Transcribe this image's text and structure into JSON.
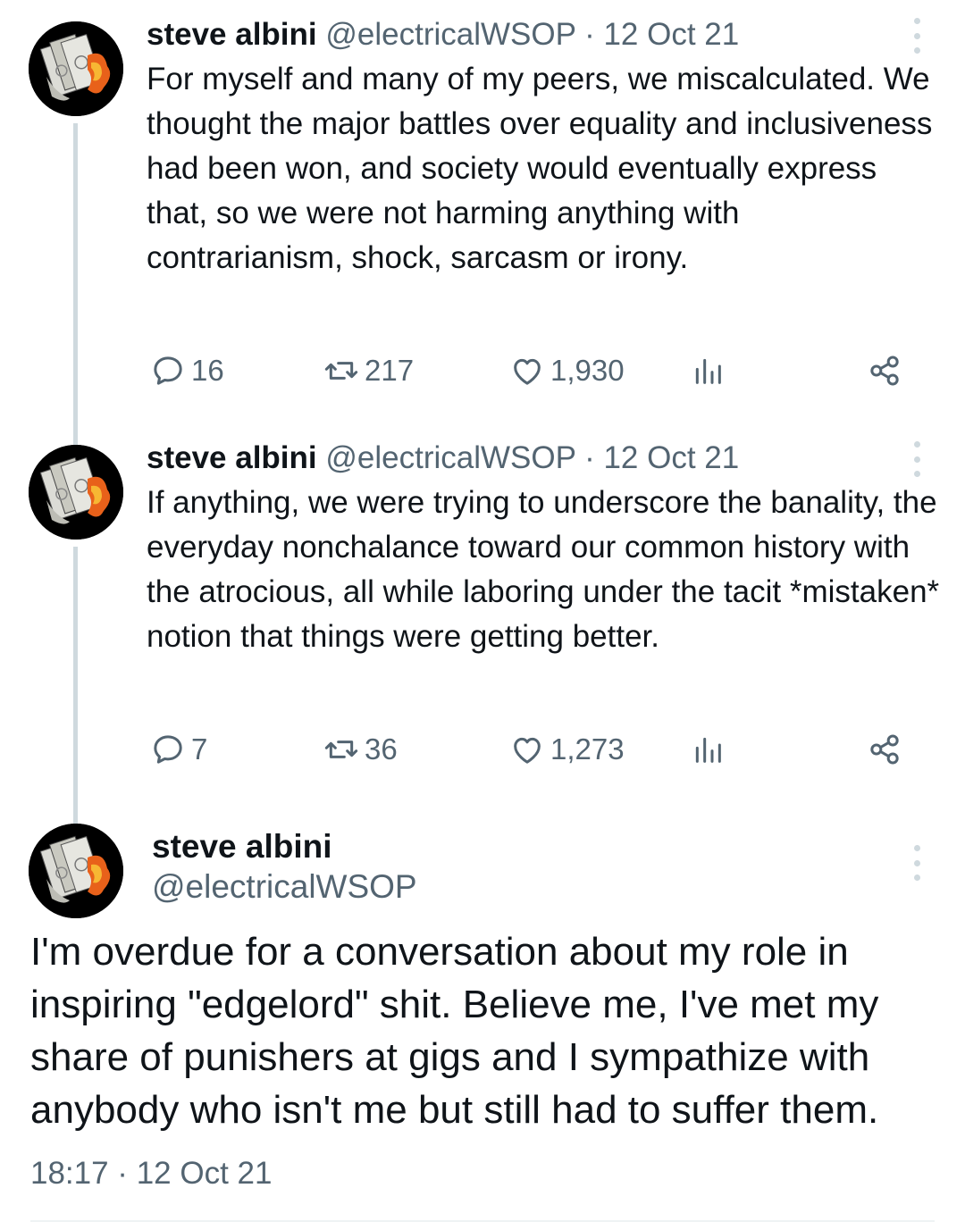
{
  "tweets": [
    {
      "name": "steve albini",
      "handle": "@electricalWSOP",
      "separator": "·",
      "date": "12 Oct 21",
      "text": "For myself and many of my peers, we miscalculated. We thought the major battles over equality and inclusiveness had been won, and society would eventually express that, so we were not harming anything with contrarianism, shock, sarcasm or irony.",
      "replies": "16",
      "retweets": "217",
      "likes": "1,930"
    },
    {
      "name": "steve albini",
      "handle": "@electricalWSOP",
      "separator": "·",
      "date": "12 Oct 21",
      "text": "If anything, we were trying to underscore the banality, the everyday nonchalance toward our common history with the atrocious, all while laboring under the tacit *mistaken* notion that things were getting better.",
      "replies": "7",
      "retweets": "36",
      "likes": "1,273"
    }
  ],
  "main_tweet": {
    "name": "steve albini",
    "handle": "@electricalWSOP",
    "text": "I'm overdue for a conversation about my role in inspiring \"edgelord\" shit. Believe me, I've met my share of punishers at gigs and I sympathize with anybody who isn't me but still had to suffer them.",
    "timestamp": "18:17 · 12 Oct 21"
  },
  "icons": {
    "reply": "speech-bubble-icon",
    "retweet": "retweet-arrows-icon",
    "like": "heart-icon",
    "views": "bar-chart-icon",
    "share": "share-nodes-icon",
    "more": "vertical-ellipsis-icon"
  },
  "colors": {
    "text": "#0f1419",
    "secondary": "#536471",
    "thread_line": "#cfd9de",
    "background": "#ffffff"
  }
}
